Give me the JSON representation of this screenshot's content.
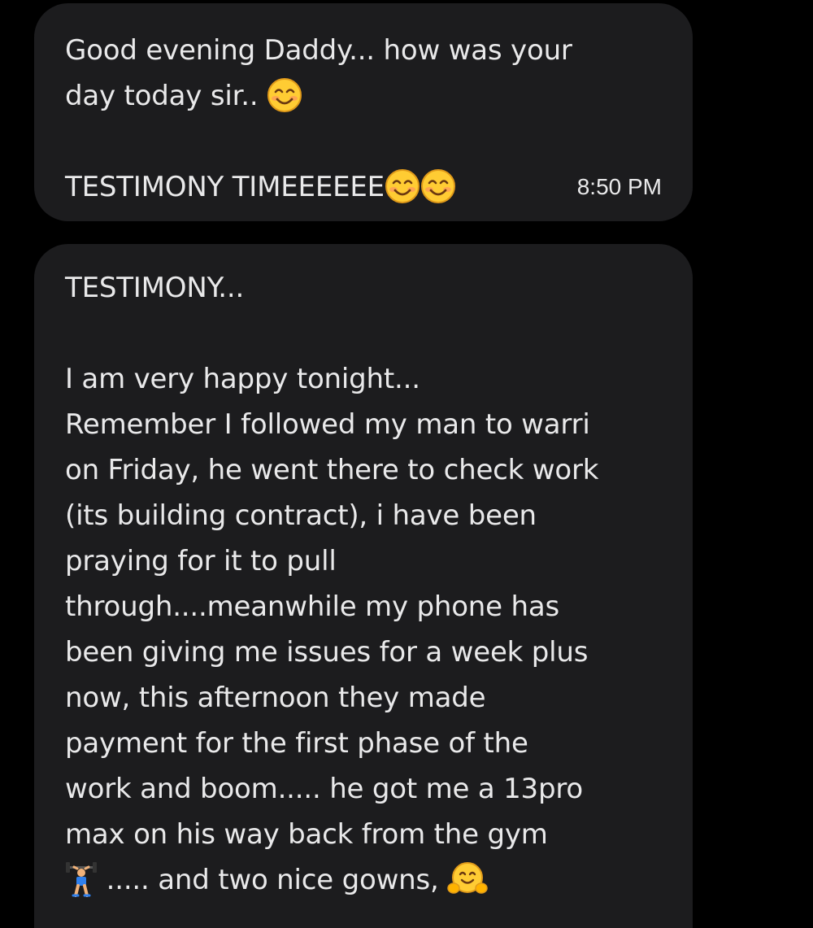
{
  "messages": [
    {
      "lines": [
        "Good evening  Daddy... how was your",
        "day today sir.. ",
        "",
        "TESTIMONY TIMEEEEEE"
      ],
      "time": "8:50 PM"
    },
    {
      "lines": [
        "TESTIMONY...",
        "",
        "I am very happy tonight...",
        "Remember I followed my man to warri",
        "on Friday, he went there to check work",
        "(its building contract), i have been",
        "praying for it to pull",
        "through....meanwhile my phone has",
        "been giving me issues for a week plus",
        "now, this afternoon they made",
        "payment for the first phase of the",
        "work and boom..... he got me a 13pro",
        "max on his way back from the gym",
        " ..... and two nice gowns,  "
      ]
    }
  ],
  "emoji": {
    "smile": "smiling-face-with-smiling-eyes-icon",
    "lifter": "woman-lifting-weights-icon",
    "hug": "hugging-face-icon"
  }
}
